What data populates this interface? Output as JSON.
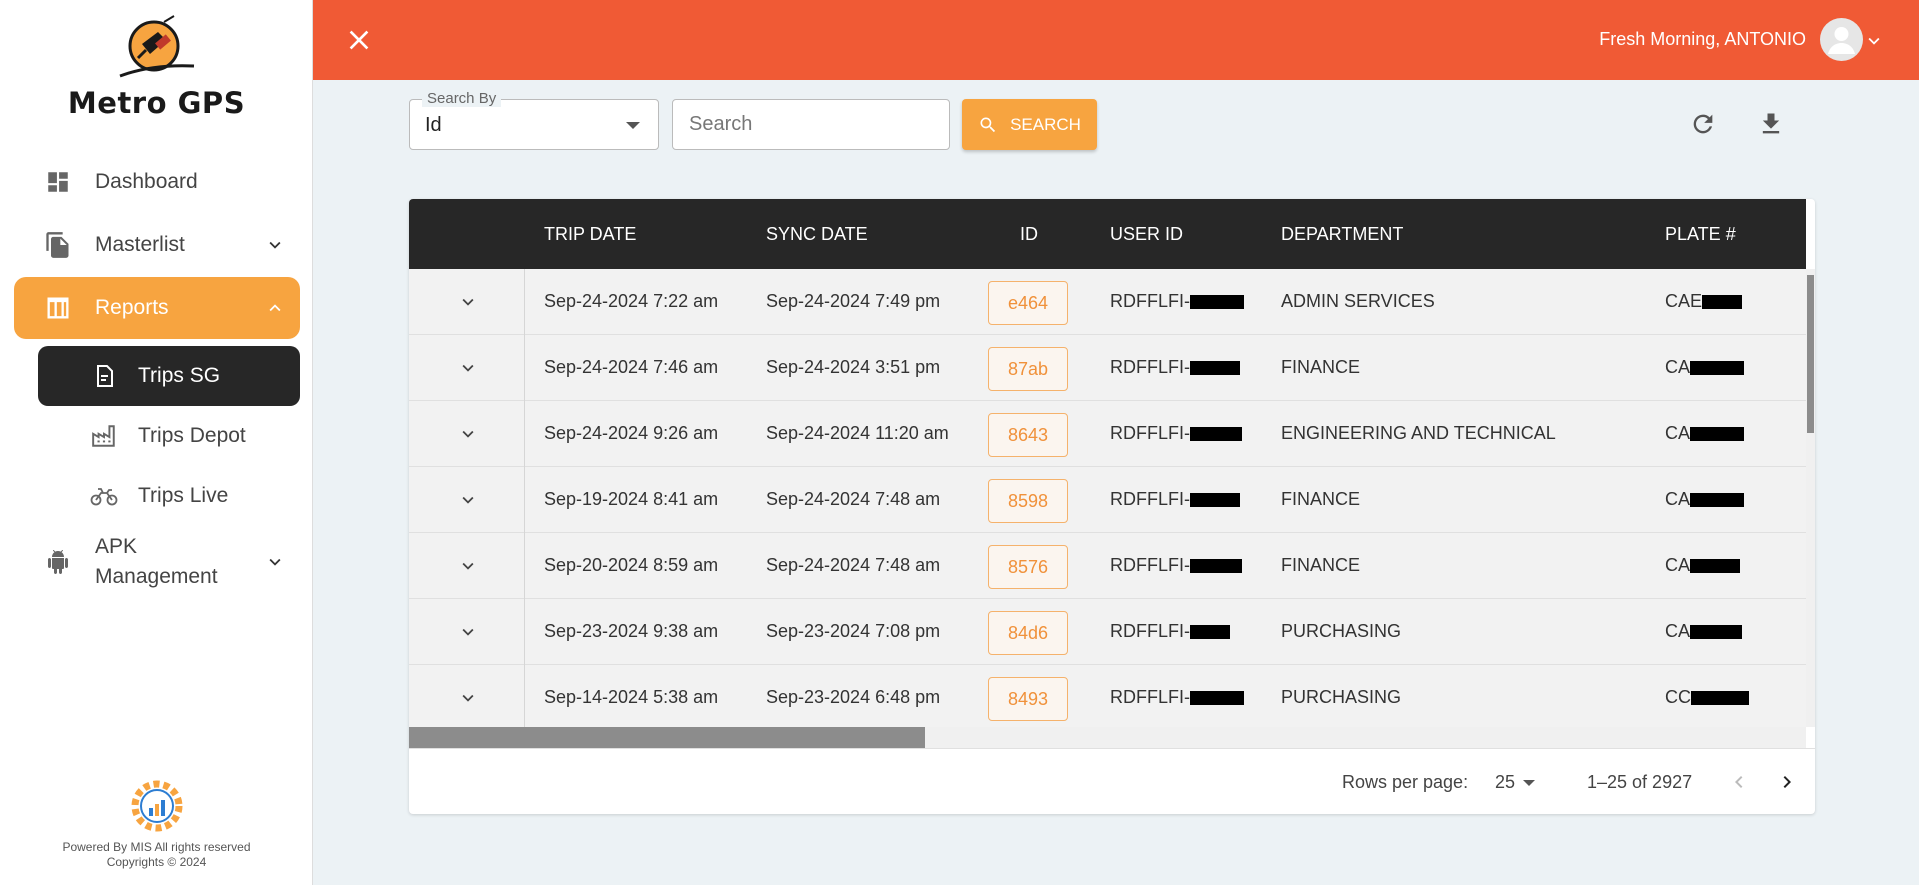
{
  "brand": {
    "name": "Metro GPS"
  },
  "sidebar": {
    "items": [
      {
        "label": "Dashboard",
        "icon": "dashboard-icon"
      },
      {
        "label": "Masterlist",
        "icon": "file-copy-icon"
      },
      {
        "label": "Reports",
        "icon": "table-icon"
      },
      {
        "label": "APK Management",
        "icon": "android-icon"
      }
    ],
    "subitems": [
      {
        "label": "Trips SG",
        "icon": "document-icon"
      },
      {
        "label": "Trips Depot",
        "icon": "factory-icon"
      },
      {
        "label": "Trips Live",
        "icon": "motorbike-icon"
      }
    ],
    "footer": {
      "line1": "Powered By MIS All rights reserved",
      "line2": "Copyrights © 2024"
    }
  },
  "header": {
    "greeting": "Fresh Morning, ANTONIO"
  },
  "toolbar": {
    "search_by_label": "Search By",
    "search_by_value": "Id",
    "search_placeholder": "Search",
    "search_button": "SEARCH"
  },
  "table": {
    "columns": [
      "TRIP DATE",
      "SYNC DATE",
      "ID",
      "USER ID",
      "DEPARTMENT",
      "PLATE #"
    ],
    "rows": [
      {
        "trip_date": "Sep-24-2024 7:22 am",
        "sync_date": "Sep-24-2024 7:49 pm",
        "id": "e464",
        "user_id": "RDFFLFI-",
        "department": "ADMIN SERVICES",
        "plate": "CAE"
      },
      {
        "trip_date": "Sep-24-2024 7:46 am",
        "sync_date": "Sep-24-2024 3:51 pm",
        "id": "87ab",
        "user_id": "RDFFLFI-",
        "department": "FINANCE",
        "plate": "CA"
      },
      {
        "trip_date": "Sep-24-2024 9:26 am",
        "sync_date": "Sep-24-2024 11:20 am",
        "id": "8643",
        "user_id": "RDFFLFI-",
        "department": "ENGINEERING AND TECHNICAL",
        "plate": "CA"
      },
      {
        "trip_date": "Sep-19-2024 8:41 am",
        "sync_date": "Sep-24-2024 7:48 am",
        "id": "8598",
        "user_id": "RDFFLFI-",
        "department": "FINANCE",
        "plate": "CA"
      },
      {
        "trip_date": "Sep-20-2024 8:59 am",
        "sync_date": "Sep-24-2024 7:48 am",
        "id": "8576",
        "user_id": "RDFFLFI-",
        "department": "FINANCE",
        "plate": "CA"
      },
      {
        "trip_date": "Sep-23-2024 9:38 am",
        "sync_date": "Sep-23-2024 7:08 pm",
        "id": "84d6",
        "user_id": "RDFFLFI-",
        "department": "PURCHASING",
        "plate": "CA"
      },
      {
        "trip_date": "Sep-14-2024 5:38 am",
        "sync_date": "Sep-23-2024 6:48 pm",
        "id": "8493",
        "user_id": "RDFFLFI-",
        "department": "PURCHASING",
        "plate": "CC"
      }
    ]
  },
  "pagination": {
    "rows_per_page_label": "Rows per page:",
    "rows_per_page_value": "25",
    "range_text": "1–25 of 2927"
  },
  "colors": {
    "header": "#f05a35",
    "accent": "#f7a440",
    "dark": "#272727"
  }
}
